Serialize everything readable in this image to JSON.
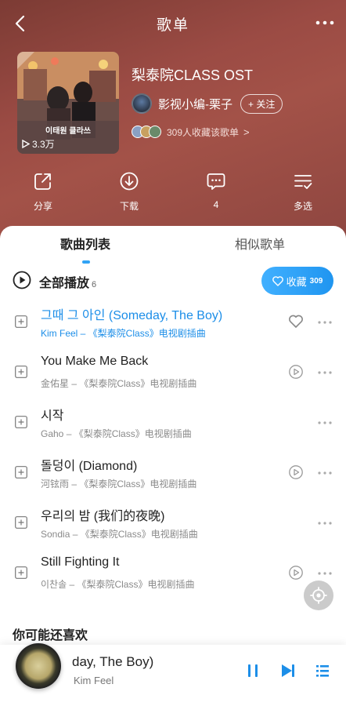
{
  "header": {
    "title": "歌单"
  },
  "playlist": {
    "cover_label": "이태원 클라쓰",
    "play_count": "3.3万",
    "title": "梨泰院CLASS OST",
    "creator": "影视小编-栗子",
    "follow_label": "+ 关注",
    "collectors_text": "309人收藏该歌单",
    "chevron": ">"
  },
  "actions": {
    "share": "分享",
    "download": "下载",
    "comments": "4",
    "multi_select": "多选"
  },
  "tabs": {
    "songs": "歌曲列表",
    "similar": "相似歌单"
  },
  "play_all": {
    "label": "全部播放",
    "count": "6",
    "collect_label": "收藏",
    "collect_count": "309"
  },
  "songs": [
    {
      "title": "그때 그 아인 (Someday, The Boy)",
      "sub": "Kim Feel – 《梨泰院Class》电视剧插曲",
      "side": "heart",
      "playing": true
    },
    {
      "title": "You Make Me Back",
      "sub": "金佑星 – 《梨泰院Class》电视剧插曲",
      "side": "mv",
      "playing": false
    },
    {
      "title": "시작",
      "sub": "Gaho – 《梨泰院Class》电视剧插曲",
      "side": "none",
      "playing": false
    },
    {
      "title": "돌덩이 (Diamond)",
      "sub": "河铉雨 – 《梨泰院Class》电视剧插曲",
      "side": "mv",
      "playing": false
    },
    {
      "title": "우리의 밤 (我们的夜晚)",
      "sub": "Sondia – 《梨泰院Class》电视剧插曲",
      "side": "none",
      "playing": false
    },
    {
      "title": "Still Fighting It",
      "sub": "이찬솔 – 《梨泰院Class》电视剧插曲",
      "side": "mv",
      "playing": false
    }
  ],
  "recommend": {
    "title": "你可能还喜欢"
  },
  "player": {
    "title": "day, The Boy)",
    "artist": "Kim Feel"
  },
  "colors": {
    "accent": "#1c8ee8",
    "header_bg": "#9b4b44"
  }
}
